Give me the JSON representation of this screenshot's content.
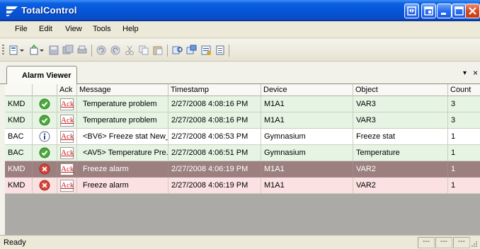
{
  "window": {
    "title": "TotalControl"
  },
  "menu": [
    "File",
    "Edit",
    "View",
    "Tools",
    "Help"
  ],
  "tab": {
    "label": "Alarm Viewer"
  },
  "panel_controls": {
    "pin": "▾",
    "close": "×"
  },
  "columns": [
    "",
    "",
    "Ack",
    "Message",
    "Timestamp",
    "Device",
    "Object",
    "Count"
  ],
  "rows": [
    {
      "source": "KMD",
      "status": "ok",
      "ack": "Ack",
      "message": "Temperature problem",
      "timestamp": "2/27/2008 4:08:16 PM",
      "device": "M1A1",
      "object": "VAR3",
      "count": "3",
      "color": "#e6f4e4",
      "selected": false
    },
    {
      "source": "KMD",
      "status": "ok",
      "ack": "Ack",
      "message": "Temperature problem",
      "timestamp": "2/27/2008 4:08:16 PM",
      "device": "M1A1",
      "object": "VAR3",
      "count": "3",
      "color": "#e6f4e4",
      "selected": false
    },
    {
      "source": "BAC",
      "status": "info",
      "ack": "Ack",
      "message": "<BV6> Freeze stat New_...",
      "timestamp": "2/27/2008 4:06:53 PM",
      "device": "Gymnasium",
      "object": "Freeze stat",
      "count": "1",
      "color": "#ffffff",
      "selected": false
    },
    {
      "source": "BAC",
      "status": "ok",
      "ack": "Ack",
      "message": "<AV5> Temperature Pre...",
      "timestamp": "2/27/2008 4:06:51 PM",
      "device": "Gymnasium",
      "object": "Temperature",
      "count": "1",
      "color": "#e6f4e4",
      "selected": false
    },
    {
      "source": "KMD",
      "status": "error",
      "ack": "Ack",
      "message": "Freeze alarm",
      "timestamp": "2/27/2008 4:06:19 PM",
      "device": "M1A1",
      "object": "VAR2",
      "count": "1",
      "color": "#9c7f7f",
      "selected": true
    },
    {
      "source": "KMD",
      "status": "error",
      "ack": "Ack",
      "message": "Freeze alarm",
      "timestamp": "2/27/2008 4:06:19 PM",
      "device": "M1A1",
      "object": "VAR2",
      "count": "1",
      "color": "#fbe1e1",
      "selected": false
    }
  ],
  "status": {
    "text": "Ready",
    "panels": [
      "---",
      "---",
      "---"
    ]
  },
  "icons": {
    "logo": "app-logo-icon",
    "ok": "check-circle-icon",
    "info": "info-circle-icon",
    "error": "error-circle-icon"
  }
}
